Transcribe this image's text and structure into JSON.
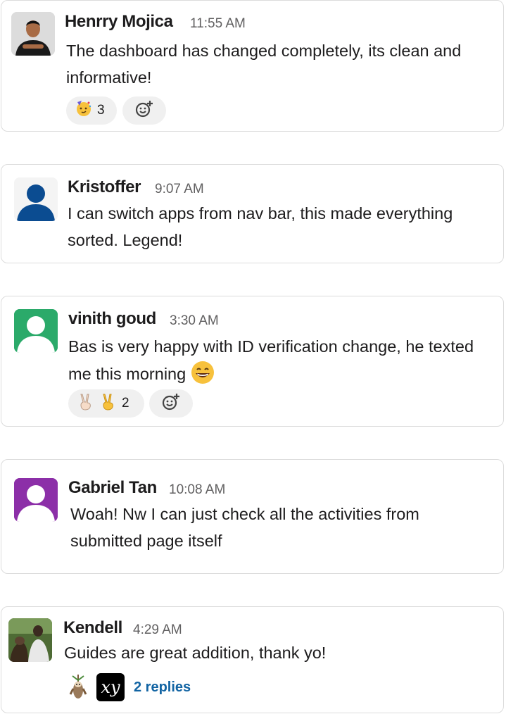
{
  "messages": [
    {
      "name": "Henrry Mojica",
      "time": "11:55 AM",
      "text": "The dashboard has changed completely, its clean and informative!",
      "reactions": [
        {
          "emoji": "partying-face-icon",
          "count": "3"
        }
      ]
    },
    {
      "name": "Kristoffer",
      "time": "9:07 AM",
      "text": "I can switch apps from nav bar, this made everything sorted. Legend!"
    },
    {
      "name": "vinith goud",
      "time": "3:30 AM",
      "text": "Bas is very happy with ID verification change, he texted me this morning",
      "inline_emoji": "grinning-face-icon",
      "reactions": [
        {
          "emoji": "victory-hand-icon",
          "count": "2"
        }
      ]
    },
    {
      "name": "Gabriel Tan",
      "time": "10:08 AM",
      "text": "Woah! Nw I can just check all the activities from submitted page itself"
    },
    {
      "name": "Kendell",
      "time": "4:29 AM",
      "text": "Guides are great addition, thank yo!",
      "thread": {
        "reply_avatar_text": "xy",
        "replies_label": "2 replies"
      }
    }
  ],
  "colors": {
    "border": "#dcdcdc",
    "link": "#1264a3",
    "default_avatar_blue": "#0b4c91",
    "default_avatar_green": "#2baa6a",
    "default_avatar_purple": "#8c2fa8"
  }
}
